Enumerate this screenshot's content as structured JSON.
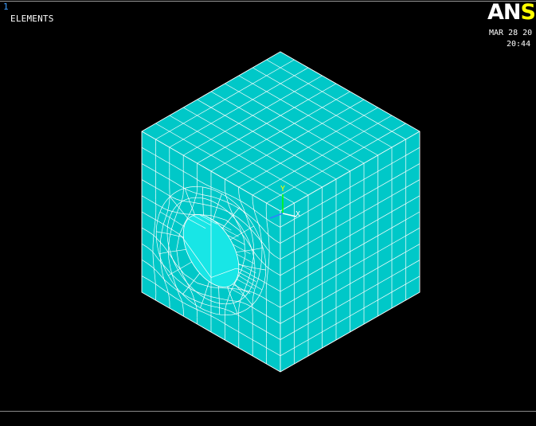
{
  "window": {
    "number": "1",
    "title": "ELEMENTS"
  },
  "logo": {
    "part1": "AN",
    "part2": "S"
  },
  "timestamp": {
    "date": "MAR 28 20",
    "time": "20:44"
  },
  "triad": {
    "x_label": "X",
    "y_label": "Y"
  },
  "colors": {
    "background": "#000000",
    "element_fill": "#00c8c8",
    "mesh_lines": "#ffffff",
    "window_number": "#3f9fff",
    "logo_accent": "#ffff00",
    "triad_x": "#ffffff",
    "triad_y": "#00ff00",
    "triad_z": "#2f7fff"
  },
  "icons": {
    "triad": "coordinate-triad-icon",
    "logo": "ansys-logo"
  }
}
